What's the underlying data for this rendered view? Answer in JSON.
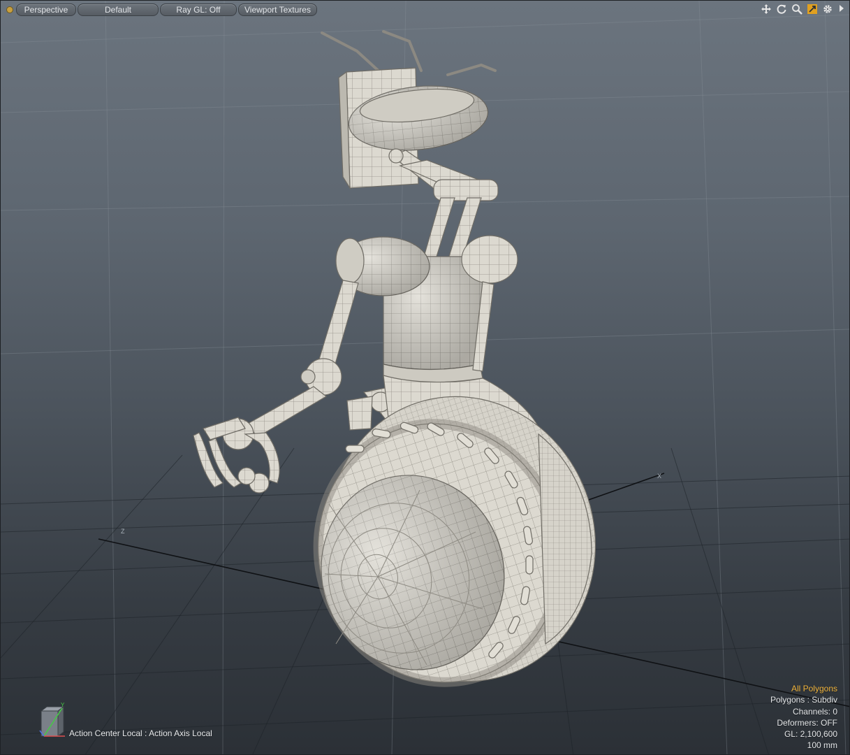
{
  "toolbar": {
    "view_mode": "Perspective",
    "shading": "Default",
    "ray_gl": "Ray GL: Off",
    "textures": "Viewport Textures",
    "icons": [
      "move-view-icon",
      "rotate-view-icon",
      "zoom-view-icon",
      "maximize-view-icon",
      "settings-gear-icon",
      "expand-arrow-icon"
    ]
  },
  "info": {
    "selection_mode": "All Polygons",
    "polygons": "Polygons : Subdiv",
    "channels": "Channels: 0",
    "deformers": "Deformers: OFF",
    "gl_count": "GL: 2,100,600",
    "grid_unit": "100 mm"
  },
  "status": {
    "action_center": "Action Center Local : Action Axis Local"
  },
  "axis_labels": {
    "y": "Y",
    "x": "X",
    "z": "Z"
  },
  "colors": {
    "accent": "#f0b43c",
    "model_surface": "#dcd9d0",
    "wire": "#8d8a82",
    "axis_y": "#46c846",
    "axis_x": "#e05050",
    "axis_z": "#5070e0"
  }
}
